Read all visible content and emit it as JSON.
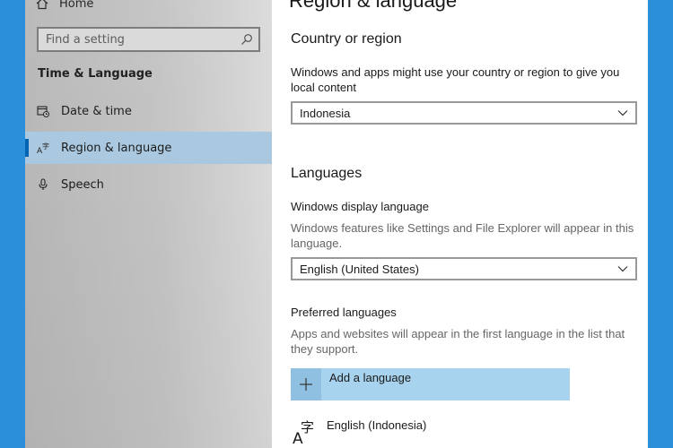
{
  "sidebar": {
    "home_label": "Home",
    "search_placeholder": "Find a setting",
    "section_title": "Time & Language",
    "items": [
      {
        "label": "Date & time",
        "icon": "calendar-clock-icon",
        "selected": false
      },
      {
        "label": "Region & language",
        "icon": "language-icon",
        "selected": true
      },
      {
        "label": "Speech",
        "icon": "microphone-icon",
        "selected": false
      }
    ]
  },
  "main": {
    "page_title": "Region & language",
    "country_section": {
      "heading": "Country or region",
      "description": "Windows and apps might use your country or region to give you local content",
      "selected_value": "Indonesia"
    },
    "languages_section": {
      "heading": "Languages",
      "display_language_label": "Windows display language",
      "display_language_description": "Windows features like Settings and File Explorer will appear in this language.",
      "display_language_value": "English (United States)",
      "preferred_label": "Preferred languages",
      "preferred_description": "Apps and websites will appear in the first language in the list that they support.",
      "add_language_label": "Add a language",
      "languages": [
        {
          "name": "English (Indonesia)",
          "icon": "language-glyph-icon"
        }
      ]
    }
  },
  "colors": {
    "accent": "#0063b1",
    "selected_bg": "#a9c8e0",
    "add_button_bg": "#a8d3ef",
    "desktop": "#2b8fd9"
  }
}
